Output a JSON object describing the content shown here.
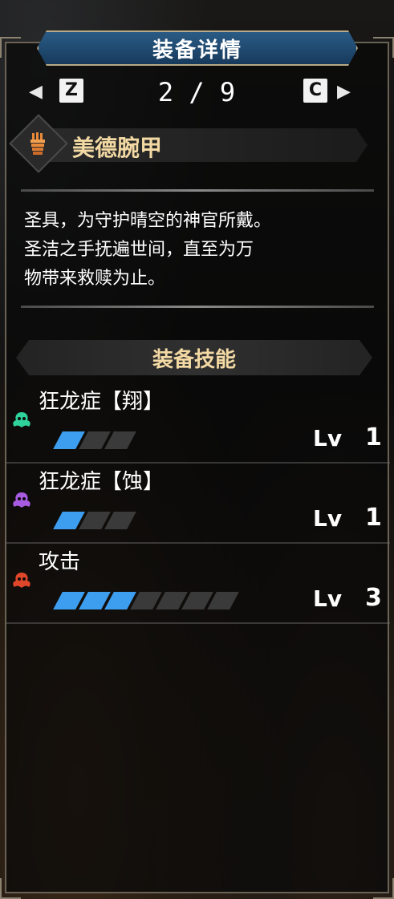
{
  "header": {
    "title": "装备详情"
  },
  "nav": {
    "prev_key": "Z",
    "next_key": "C",
    "page": "2 / 9",
    "left_arrow": "◀",
    "right_arrow": "▶"
  },
  "item": {
    "name": "美德腕甲",
    "icon": "arm-armor-icon",
    "description": "圣具，为守护晴空的神官所戴。\n圣洁之手抚遍世间，直至为万\n物带来救赎为止。"
  },
  "skills_section": {
    "title": "装备技能"
  },
  "skills": [
    {
      "name": "狂龙症【翔】",
      "icon": "skill-icon-green",
      "icon_color": "#2fd29a",
      "level_label": "Lv",
      "level": "1",
      "filled": 1,
      "total": 3
    },
    {
      "name": "狂龙症【蚀】",
      "icon": "skill-icon-purple",
      "icon_color": "#a65be0",
      "level_label": "Lv",
      "level": "1",
      "filled": 1,
      "total": 3
    },
    {
      "name": "攻击",
      "icon": "skill-icon-red",
      "icon_color": "#e0462a",
      "level_label": "Lv",
      "level": "3",
      "filled": 3,
      "total": 7
    }
  ]
}
